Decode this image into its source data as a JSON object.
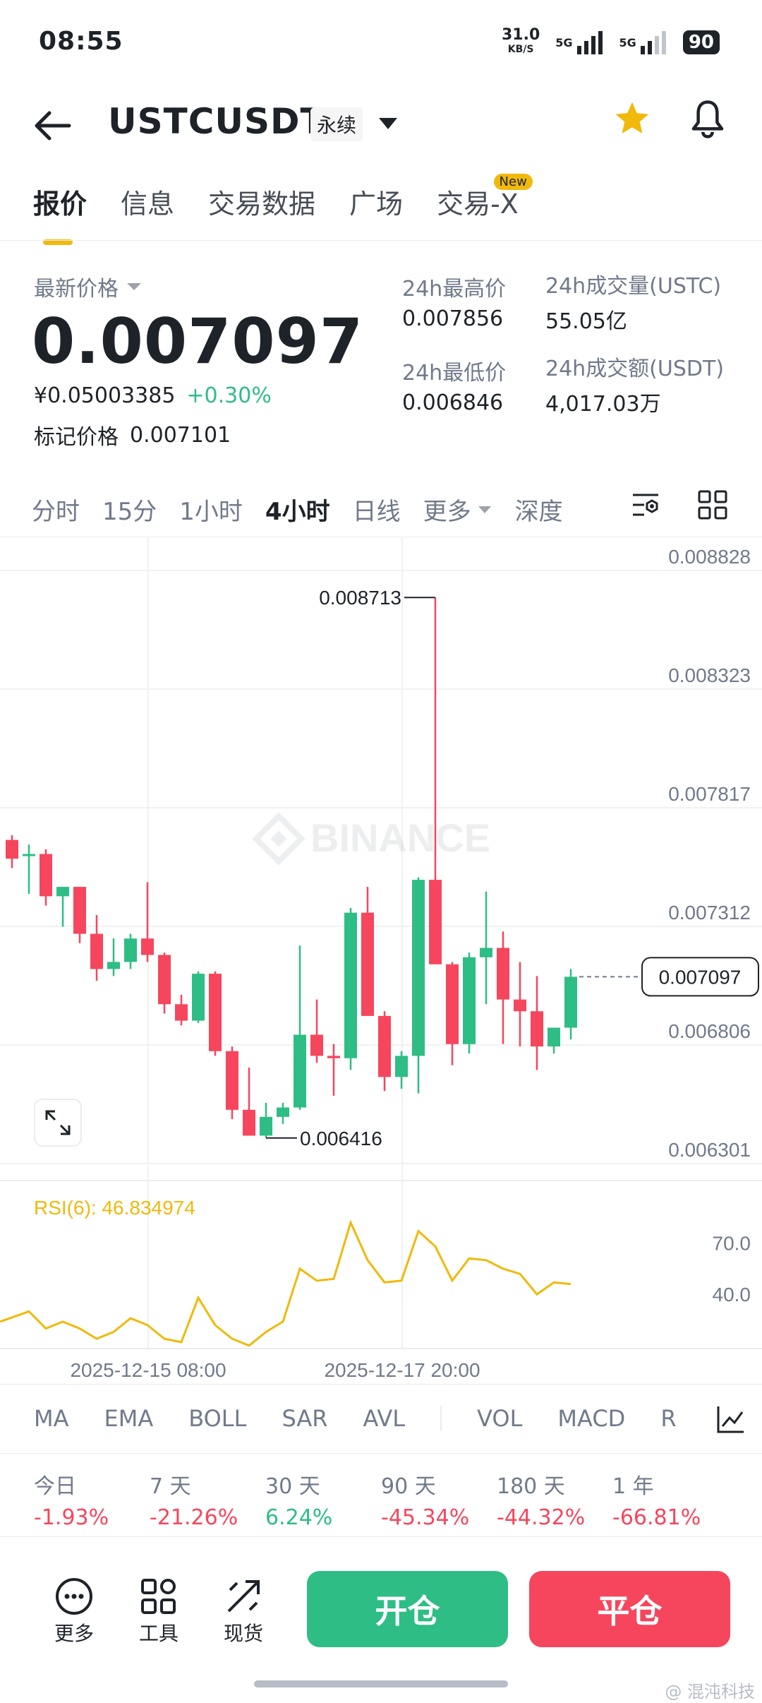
{
  "status_bar": {
    "time": "08:55",
    "net_speed": "31.0",
    "net_unit": "KB/S",
    "sig1": "5G",
    "sig2": "5G",
    "battery": "90"
  },
  "header": {
    "symbol": "USTCUSDT",
    "contract_type": "永续"
  },
  "tabs": [
    {
      "label": "报价",
      "active": true
    },
    {
      "label": "信息"
    },
    {
      "label": "交易数据"
    },
    {
      "label": "广场"
    },
    {
      "label": "交易-X",
      "badge": "New"
    }
  ],
  "price": {
    "last_price_label": "最新价格",
    "last_price": "0.007097",
    "cny_price": "¥0.05003385",
    "change_pct": "+0.30%",
    "mark_label": "标记价格",
    "mark_price": "0.007101"
  },
  "stats": {
    "high_label": "24h最高价",
    "high": "0.007856",
    "low_label": "24h最低价",
    "low": "0.006846",
    "vol_label": "24h成交量(USTC)",
    "vol": "55.05亿",
    "amount_label": "24h成交额(USDT)",
    "amount": "4,017.03万"
  },
  "intervals": [
    "分时",
    "15分",
    "1小时",
    "4小时",
    "日线",
    "更多",
    "深度"
  ],
  "selected_interval": "4小时",
  "colors": {
    "up": "#2ebd85",
    "down": "#f6465d",
    "accent": "#f0b90b",
    "rsi": "#f0b90b"
  },
  "chart_data": {
    "type": "candlestick",
    "y_ticks": [
      "0.008828",
      "0.008323",
      "0.007817",
      "0.007312",
      "0.006806",
      "0.006301"
    ],
    "ylim": [
      0.006301,
      0.008828
    ],
    "x_ticks": [
      "2025-12-15 08:00",
      "2025-12-17 20:00"
    ],
    "watermark": "BINANCE",
    "high_annotation": "0.008713",
    "low_annotation": "0.006416",
    "current_price_label": "0.007097",
    "candles": [
      {
        "o": 7680,
        "h": 7700,
        "l": 7560,
        "c": 7600
      },
      {
        "o": 7620,
        "h": 7660,
        "l": 7450,
        "c": 7620
      },
      {
        "o": 7620,
        "h": 7640,
        "l": 7400,
        "c": 7440
      },
      {
        "o": 7440,
        "h": 7480,
        "l": 7310,
        "c": 7480
      },
      {
        "o": 7480,
        "h": 7480,
        "l": 7240,
        "c": 7280
      },
      {
        "o": 7280,
        "h": 7360,
        "l": 7080,
        "c": 7130
      },
      {
        "o": 7130,
        "h": 7260,
        "l": 7100,
        "c": 7160
      },
      {
        "o": 7160,
        "h": 7280,
        "l": 7130,
        "c": 7260
      },
      {
        "o": 7260,
        "h": 7500,
        "l": 7160,
        "c": 7190
      },
      {
        "o": 7190,
        "h": 7200,
        "l": 6940,
        "c": 6980
      },
      {
        "o": 6980,
        "h": 7020,
        "l": 6890,
        "c": 6910
      },
      {
        "o": 6910,
        "h": 7120,
        "l": 6900,
        "c": 7110
      },
      {
        "o": 7110,
        "h": 7120,
        "l": 6760,
        "c": 6780
      },
      {
        "o": 6780,
        "h": 6800,
        "l": 6490,
        "c": 6530
      },
      {
        "o": 6530,
        "h": 6710,
        "l": 6430,
        "c": 6420
      },
      {
        "o": 6420,
        "h": 6560,
        "l": 6410,
        "c": 6500
      },
      {
        "o": 6500,
        "h": 6560,
        "l": 6470,
        "c": 6540
      },
      {
        "o": 6540,
        "h": 7230,
        "l": 6530,
        "c": 6850
      },
      {
        "o": 6850,
        "h": 7000,
        "l": 6730,
        "c": 6760
      },
      {
        "o": 6760,
        "h": 6810,
        "l": 6590,
        "c": 6750
      },
      {
        "o": 6750,
        "h": 7390,
        "l": 6700,
        "c": 7370
      },
      {
        "o": 7370,
        "h": 7480,
        "l": 7270,
        "c": 6930
      },
      {
        "o": 6930,
        "h": 6950,
        "l": 6610,
        "c": 6670
      },
      {
        "o": 6670,
        "h": 6780,
        "l": 6620,
        "c": 6760
      },
      {
        "o": 6760,
        "h": 7520,
        "l": 6600,
        "c": 7510
      },
      {
        "o": 7510,
        "h": 8713,
        "l": 7270,
        "c": 7150
      },
      {
        "o": 7150,
        "h": 7160,
        "l": 6720,
        "c": 6810
      },
      {
        "o": 6810,
        "h": 7200,
        "l": 6770,
        "c": 7180
      },
      {
        "o": 7180,
        "h": 7460,
        "l": 6980,
        "c": 7220
      },
      {
        "o": 7220,
        "h": 7290,
        "l": 6810,
        "c": 7000
      },
      {
        "o": 7000,
        "h": 7160,
        "l": 6800,
        "c": 6950
      },
      {
        "o": 6950,
        "h": 7100,
        "l": 6700,
        "c": 6800
      },
      {
        "o": 6800,
        "h": 6880,
        "l": 6770,
        "c": 6880
      },
      {
        "o": 6880,
        "h": 7130,
        "l": 6830,
        "c": 7097
      }
    ],
    "rsi": {
      "label": "RSI(6): 46.834974",
      "y_ticks": [
        "70.0",
        "40.0"
      ],
      "values": [
        24,
        30,
        20,
        24,
        20,
        14,
        18,
        26,
        22,
        14,
        12,
        38,
        22,
        14,
        10,
        18,
        24,
        55,
        48,
        49,
        82,
        60,
        47,
        48,
        77,
        68,
        48,
        61,
        60,
        55,
        52,
        40,
        47,
        46
      ]
    }
  },
  "indicators": [
    "MA",
    "EMA",
    "BOLL",
    "SAR",
    "AVL",
    "VOL",
    "MACD",
    "R"
  ],
  "performance": [
    {
      "label": "今日",
      "value": "-1.93%",
      "dir": "down"
    },
    {
      "label": "7 天",
      "value": "-21.26%",
      "dir": "down"
    },
    {
      "label": "30 天",
      "value": "6.24%",
      "dir": "up"
    },
    {
      "label": "90 天",
      "value": "-45.34%",
      "dir": "down"
    },
    {
      "label": "180 天",
      "value": "-44.32%",
      "dir": "down"
    },
    {
      "label": "1 年",
      "value": "-66.81%",
      "dir": "down"
    }
  ],
  "bottom_bar": {
    "more": "更多",
    "tools": "工具",
    "spot": "现货",
    "open": "开仓",
    "close": "平仓"
  },
  "watermark_bottom": "@ 混沌科技"
}
